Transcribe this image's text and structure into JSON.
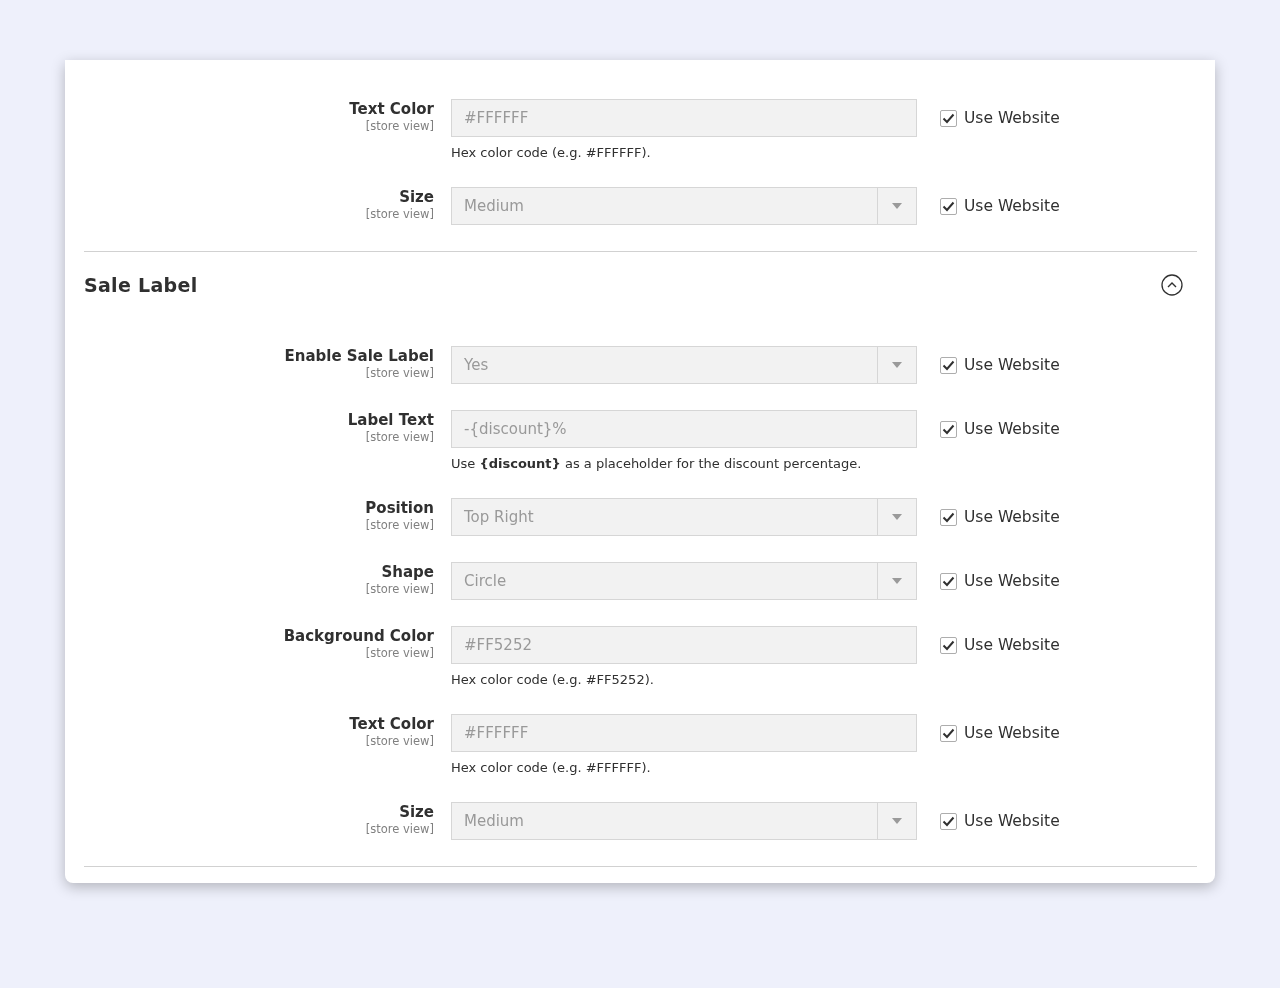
{
  "top_rows": [
    {
      "kind": "text",
      "label": "Text Color",
      "scope": "[store view]",
      "value": "#FFFFFF",
      "disabled": true,
      "note": "Hex color code (e.g. #FFFFFF).",
      "use_website": {
        "label": "Use Website",
        "checked": true
      }
    },
    {
      "kind": "select",
      "label": "Size",
      "scope": "[store view]",
      "value": "Medium",
      "disabled": true,
      "use_website": {
        "label": "Use Website",
        "checked": true
      }
    }
  ],
  "section": {
    "title": "Sale Label",
    "expanded": true,
    "rows": [
      {
        "kind": "select",
        "label": "Enable Sale Label",
        "scope": "[store view]",
        "value": "Yes",
        "disabled": true,
        "use_website": {
          "label": "Use Website",
          "checked": true
        }
      },
      {
        "kind": "text",
        "label": "Label Text",
        "scope": "[store view]",
        "value": "-{discount}%",
        "disabled": true,
        "note": "Use **{discount}** as a placeholder for the discount percentage.",
        "use_website": {
          "label": "Use Website",
          "checked": true
        }
      },
      {
        "kind": "select",
        "label": "Position",
        "scope": "[store view]",
        "value": "Top Right",
        "disabled": true,
        "use_website": {
          "label": "Use Website",
          "checked": true
        }
      },
      {
        "kind": "select",
        "label": "Shape",
        "scope": "[store view]",
        "value": "Circle",
        "disabled": true,
        "use_website": {
          "label": "Use Website",
          "checked": true
        }
      },
      {
        "kind": "text",
        "label": "Background Color",
        "scope": "[store view]",
        "value": "#FF5252",
        "disabled": true,
        "note": "Hex color code (e.g. #FF5252).",
        "use_website": {
          "label": "Use Website",
          "checked": true
        }
      },
      {
        "kind": "text",
        "label": "Text Color",
        "scope": "[store view]",
        "value": "#FFFFFF",
        "disabled": true,
        "note": "Hex color code (e.g. #FFFFFF).",
        "use_website": {
          "label": "Use Website",
          "checked": true
        }
      },
      {
        "kind": "select",
        "label": "Size",
        "scope": "[store view]",
        "value": "Medium",
        "disabled": true,
        "use_website": {
          "label": "Use Website",
          "checked": true
        }
      }
    ]
  }
}
